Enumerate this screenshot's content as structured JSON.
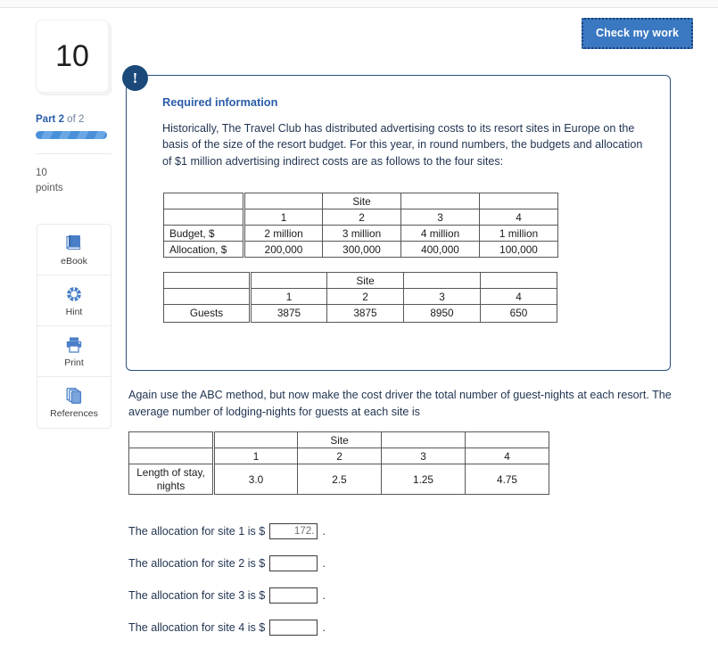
{
  "header": {
    "check_work_label": "Check my work"
  },
  "rail": {
    "question_number": "10",
    "part_prefix": "Part ",
    "part_current": "2",
    "part_of": " of ",
    "part_total": "2",
    "points_value": "10",
    "points_label": "points",
    "tools": [
      {
        "name": "ebook",
        "label": "eBook",
        "icon": "book-icon"
      },
      {
        "name": "hint",
        "label": "Hint",
        "icon": "life-ring-icon"
      },
      {
        "name": "print",
        "label": "Print",
        "icon": "printer-icon"
      },
      {
        "name": "references",
        "label": "References",
        "icon": "copy-pages-icon"
      }
    ]
  },
  "panel": {
    "badge_glyph": "!",
    "title": "Required information",
    "body": "Historically, The Travel Club has distributed advertising costs to its resort sites in Europe on the basis of the size of the resort budget. For this year, in round numbers, the budgets and allocation of $1 million advertising indirect costs are as follows to the four sites:"
  },
  "table_budget": {
    "group_header": "Site",
    "site_numbers": [
      "1",
      "2",
      "3",
      "4"
    ],
    "rows": [
      {
        "label": "Budget, $",
        "values": [
          "2 million",
          "3 million",
          "4 million",
          "1 million"
        ]
      },
      {
        "label": "Allocation, $",
        "values": [
          "200,000",
          "300,000",
          "400,000",
          "100,000"
        ]
      }
    ]
  },
  "table_guests": {
    "group_header": "Site",
    "site_numbers": [
      "1",
      "2",
      "3",
      "4"
    ],
    "rows": [
      {
        "label": "Guests",
        "values": [
          "3875",
          "3875",
          "8950",
          "650"
        ]
      }
    ]
  },
  "mid_paragraph": "Again use the ABC method, but now make the cost driver the total number of guest-nights at each resort. The average number of lodging-nights for guests at each site is",
  "table_stay": {
    "group_header": "Site",
    "site_numbers": [
      "1",
      "2",
      "3",
      "4"
    ],
    "rows": [
      {
        "label": "Length of stay, nights",
        "values": [
          "3.0",
          "2.5",
          "1.25",
          "4.75"
        ]
      }
    ]
  },
  "answers": [
    {
      "text": "The allocation for site 1 is $",
      "value": "172.",
      "placeholder": "",
      "period": "."
    },
    {
      "text": "The allocation for site 2 is $",
      "value": "",
      "placeholder": "",
      "period": "."
    },
    {
      "text": "The allocation for site 3 is $",
      "value": "",
      "placeholder": "",
      "period": "."
    },
    {
      "text": "The allocation for site 4 is $",
      "value": "",
      "placeholder": "",
      "period": "."
    }
  ],
  "colors": {
    "accent_blue": "#3a78c2",
    "panel_border": "#2a4f7c",
    "badge": "#1b4a7a",
    "link_blue": "#2a5ca8",
    "body_text": "#1f3350"
  }
}
